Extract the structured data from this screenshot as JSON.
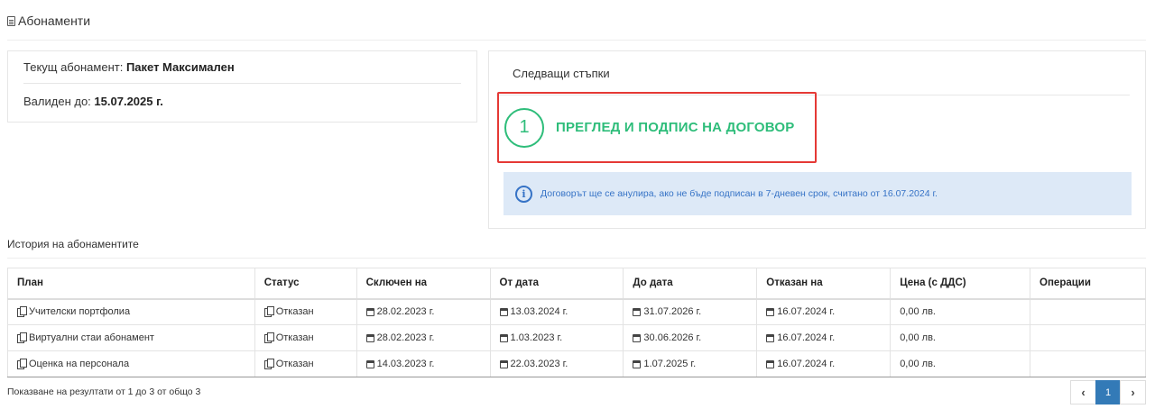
{
  "header": {
    "title": "Абонаменти",
    "icon": "document-icon"
  },
  "current": {
    "label": "Текущ абонамент:",
    "plan": "Пакет Максимален",
    "valid_label": "Валиден до:",
    "valid_date": "15.07.2025 г."
  },
  "next_steps": {
    "title": "Следващи стъпки",
    "step_number": "1",
    "step_label": "ПРЕГЛЕД И ПОДПИС НА ДОГОВОР",
    "info": "Договорът ще се анулира, ако не бъде подписан в 7-дневен срок, считано от 16.07.2024 г."
  },
  "history": {
    "title": "История на абонаментите",
    "columns": [
      "План",
      "Статус",
      "Сключен на",
      "От дата",
      "До дата",
      "Отказан на",
      "Цена (с ДДС)",
      "Операции"
    ],
    "rows": [
      [
        "Учителски портфолиа",
        "Отказан",
        "28.02.2023 г.",
        "13.03.2024 г.",
        "31.07.2026 г.",
        "16.07.2024 г.",
        "0,00 лв.",
        ""
      ],
      [
        "Виртуални стаи абонамент",
        "Отказан",
        "28.02.2023 г.",
        "1.03.2023 г.",
        "30.06.2026 г.",
        "16.07.2024 г.",
        "0,00 лв.",
        ""
      ],
      [
        "Оценка на персонала",
        "Отказан",
        "14.03.2023 г.",
        "22.03.2023 г.",
        "1.07.2025 г.",
        "16.07.2024 г.",
        "0,00 лв.",
        ""
      ]
    ]
  },
  "footer": {
    "summary": "Показване на резултати от 1 до 3 от общо 3",
    "pages": [
      "‹",
      "1",
      "›"
    ],
    "active_page": "1"
  },
  "colors": {
    "accent_green": "#2ebd7a",
    "highlight_red": "#e53935",
    "info_bg": "#dde9f7",
    "info_text": "#3673c6",
    "pager_active": "#337ab7"
  }
}
